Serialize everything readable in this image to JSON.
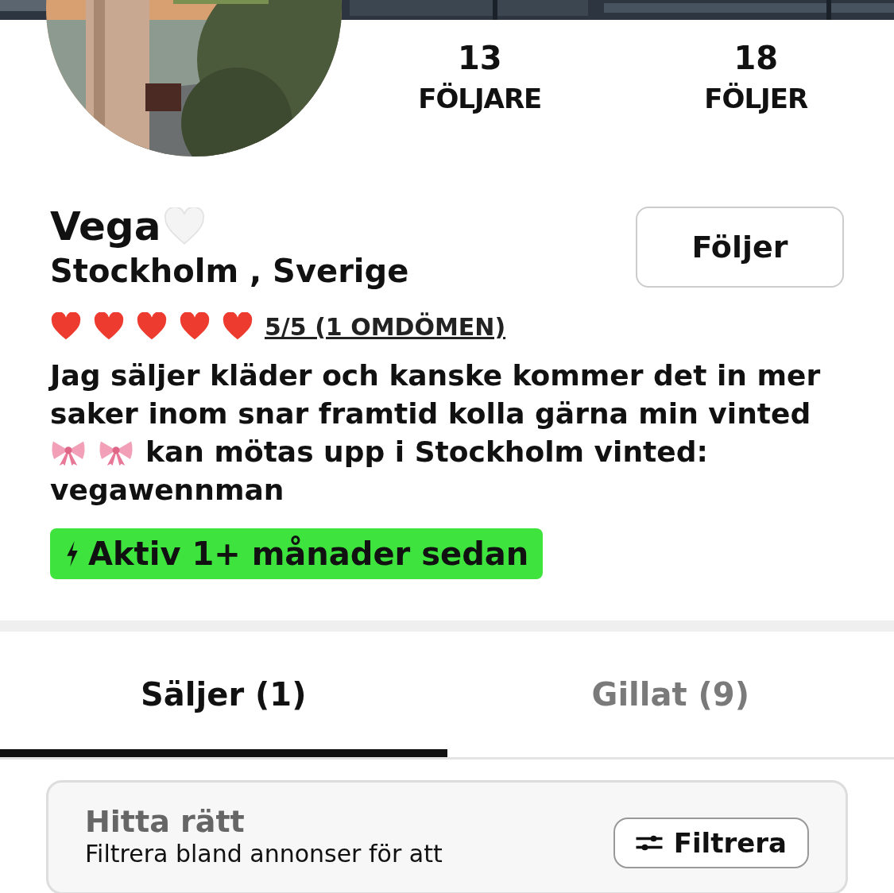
{
  "stats": [
    {
      "value": "13",
      "label": "FÖLJARE"
    },
    {
      "value": "18",
      "label": "FÖLJER"
    }
  ],
  "profile": {
    "name": "Vega",
    "location": "Stockholm , Sverige",
    "follow_button": "Följer",
    "stars": 5,
    "rating": "5/5 (1 OMDÖMEN)"
  },
  "bio": [
    [
      {
        "kind": "text",
        "text": "Jag säljer kläder och kanske kommer det in mer saker inom snar framtid kolla gärna min vinted"
      }
    ],
    [
      {
        "kind": "bow"
      },
      {
        "kind": "bow"
      },
      {
        "kind": "text",
        "text": "kan mötas upp i Stockholm vinted:"
      }
    ],
    [
      {
        "kind": "text",
        "text": "vegawennman"
      }
    ]
  ],
  "activity": "Aktiv 1+ månader sedan",
  "tabs": [
    {
      "label": "Säljer (1)",
      "selected": true
    },
    {
      "label": "Gillat (9)",
      "selected": false
    }
  ],
  "filter_card": {
    "title": "Hitta rätt",
    "text": "Filtrera bland annonser för att",
    "button": "Filtrera"
  }
}
